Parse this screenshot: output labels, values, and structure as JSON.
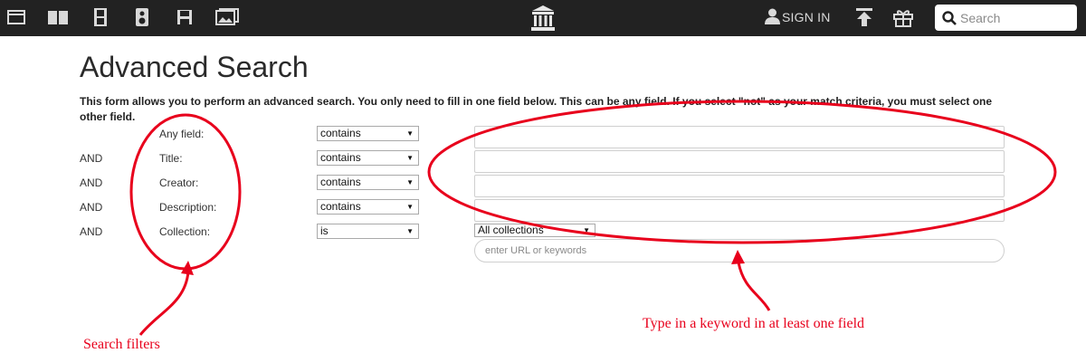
{
  "topbar": {
    "icons": [
      "web-icon",
      "texts-icon",
      "video-icon",
      "audio-icon",
      "software-icon",
      "images-icon",
      "archive-logo-icon",
      "user-icon",
      "upload-icon",
      "donate-gift-icon",
      "search-icon"
    ],
    "signin_label": "SIGN IN",
    "search_placeholder": "Search"
  },
  "main": {
    "title": "Advanced Search",
    "intro": "This form allows you to perform an advanced search. You only need to fill in one field below. This can be any field. If you select \"not\" as your match criteria, you must select one other field.",
    "rows": [
      {
        "conj": "",
        "label": "Any field:",
        "match": "contains"
      },
      {
        "conj": "AND",
        "label": "Title:",
        "match": "contains"
      },
      {
        "conj": "AND",
        "label": "Creator:",
        "match": "contains"
      },
      {
        "conj": "AND",
        "label": "Description:",
        "match": "contains"
      },
      {
        "conj": "AND",
        "label": "Collection:",
        "match": "is"
      }
    ],
    "collection_select": "All collections",
    "url_placeholder": "enter URL or keywords"
  },
  "annotations": {
    "left_label": "Search filters",
    "right_label": "Type in a keyword in at least one field",
    "color": "#e8001c"
  }
}
